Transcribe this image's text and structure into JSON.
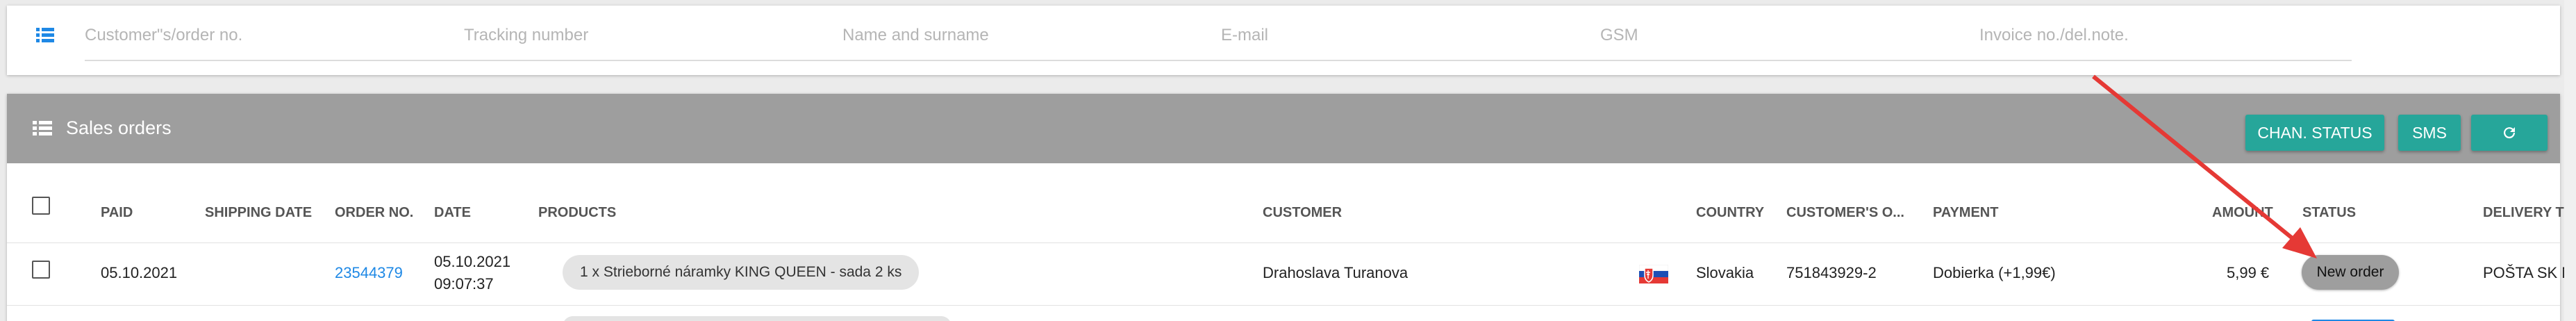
{
  "filters": {
    "customer_order_placeholder": "Customer\"s/order no.",
    "tracking_placeholder": "Tracking number",
    "name_placeholder": "Name and surname",
    "email_placeholder": "E-mail",
    "gsm_placeholder": "GSM",
    "invoice_placeholder": "Invoice no./del.note."
  },
  "orders": {
    "title": "Sales orders",
    "buttons": {
      "change_status": "CHAN. STATUS",
      "sms": "SMS",
      "refresh_icon": "refresh-icon"
    },
    "columns": {
      "paid": "PAID",
      "shipping_date": "SHIPPING DATE",
      "order_no": "ORDER NO.",
      "date": "DATE",
      "products": "PRODUCTS",
      "customer": "CUSTOMER",
      "country": "COUNTRY",
      "customer_o": "CUSTOMER'S O...",
      "payment": "PAYMENT",
      "amount": "AMOUNT",
      "status": "STATUS",
      "delivery": "DELIVERY TY"
    },
    "rows": [
      {
        "paid": "05.10.2021",
        "shipping_date": "",
        "order_no": "23544379",
        "date": "05.10.2021",
        "time": "09:07:37",
        "product": "1 x Strieborné náramky KING QUEEN - sada 2 ks",
        "customer": "Drahoslava Turanova",
        "country": "Slovakia",
        "customer_order": "751843929-2",
        "payment": "Dobierka (+1,99€)",
        "amount": "5,99 €",
        "status": "New order",
        "delivery": "POŠTA SK N"
      }
    ]
  },
  "colors": {
    "accent": "#26a69a",
    "header": "#9e9e9e",
    "link": "#1e88e5",
    "annotation_arrow": "#e53935"
  }
}
